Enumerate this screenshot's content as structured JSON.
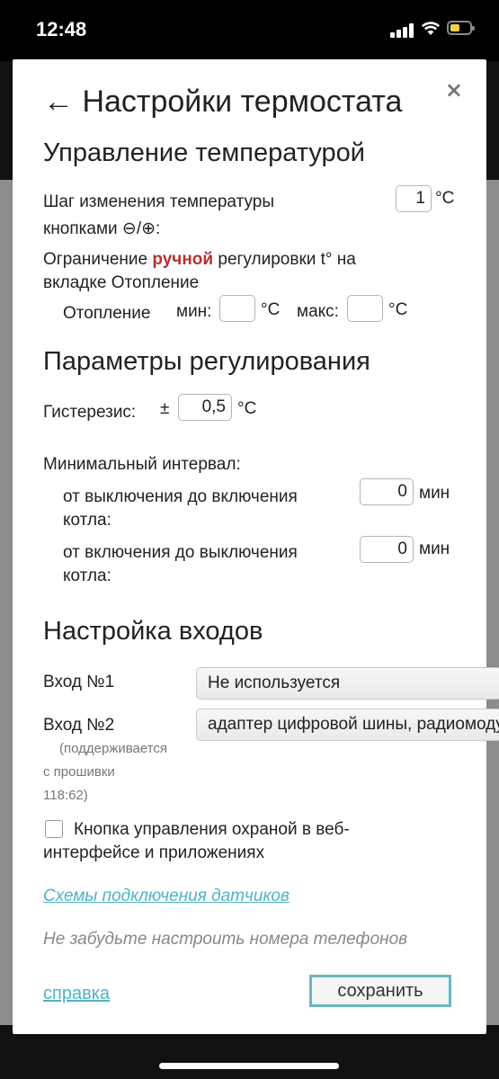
{
  "status_bar": {
    "time": "12:48"
  },
  "dialog": {
    "title": "← Настройки термостата",
    "close": "×"
  },
  "temperature": {
    "heading": "Управление температурой",
    "step_label_1": "Шаг изменения температуры",
    "step_label_2": "кнопками ⊖/⊕:",
    "step_value": "1",
    "unit_c": "°C",
    "limit_label_1a": "Ограничение ",
    "limit_label_1b": "ручной",
    "limit_label_1c": " регулировки t° на",
    "limit_label_2": "вкладке Отопление",
    "heating_label": "Отопление",
    "min_label": "мин:",
    "min_value": "",
    "max_label": "макс:",
    "max_value": ""
  },
  "regulation": {
    "heading": "Параметры регулирования",
    "hysteresis_label": "Гистерезис:",
    "pm": "±",
    "hysteresis_value": "0,5",
    "min_interval_label": "Минимальный интервал:",
    "off_on_label_1": "от выключения до включения",
    "off_on_label_2": "котла:",
    "off_on_value": "0",
    "on_off_label_1": "от включения до выключения",
    "on_off_label_2": "котла:",
    "on_off_value": "0",
    "unit_min": "мин"
  },
  "inputs": {
    "heading": "Настройка входов",
    "input1_label": "Вход №1",
    "input1_value": "Не используется",
    "input2_label": "Вход №2",
    "input2_value": "адаптер цифровой шины, радиомодуль",
    "input2_note_1": "(поддерживается",
    "input2_note_2": "с прошивки",
    "input2_note_3": "118:62)",
    "security_label_1": "Кнопка управления охраной в веб-",
    "security_label_2": "интерфейсе и приложениях"
  },
  "footer": {
    "schemes_link": "Схемы подключения датчиков",
    "phones_note": "Не забудьте настроить номера телефонов",
    "help_link": "справка",
    "save_button": "сохранить"
  }
}
